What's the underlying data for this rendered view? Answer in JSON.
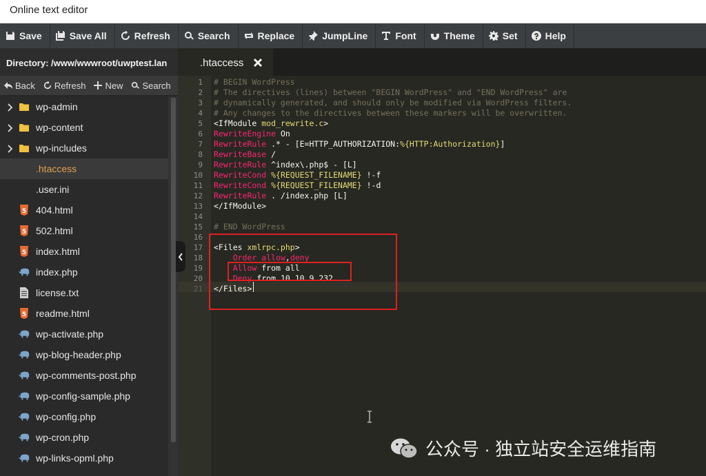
{
  "window": {
    "title": "Online text editor"
  },
  "toolbar": {
    "buttons": [
      {
        "label": "Save",
        "icon": "floppy-icon"
      },
      {
        "label": "Save All",
        "icon": "save-all-icon"
      },
      {
        "label": "Refresh",
        "icon": "refresh-icon"
      },
      {
        "label": "Search",
        "icon": "search-icon"
      },
      {
        "label": "Replace",
        "icon": "replace-icon"
      },
      {
        "label": "JumpLine",
        "icon": "pin-icon"
      },
      {
        "label": "Font",
        "icon": "font-icon"
      },
      {
        "label": "Theme",
        "icon": "magnet-icon"
      },
      {
        "label": "Set",
        "icon": "gear-icon"
      },
      {
        "label": "Help",
        "icon": "help-icon"
      }
    ]
  },
  "sidebar": {
    "directory": "Directory: /www/wwwroot/uwptest.lan",
    "actions": [
      {
        "label": "Back",
        "icon": "back-icon"
      },
      {
        "label": "Refresh",
        "icon": "refresh-icon"
      },
      {
        "label": "New",
        "icon": "plus-icon"
      },
      {
        "label": "Search",
        "icon": "search-icon"
      }
    ],
    "items": [
      {
        "name": "wp-admin",
        "type": "folder"
      },
      {
        "name": "wp-content",
        "type": "folder"
      },
      {
        "name": "wp-includes",
        "type": "folder"
      },
      {
        "name": ".htaccess",
        "type": "file-plain",
        "active": true
      },
      {
        "name": ".user.ini",
        "type": "file-plain"
      },
      {
        "name": "404.html",
        "type": "html"
      },
      {
        "name": "502.html",
        "type": "html"
      },
      {
        "name": "index.html",
        "type": "html"
      },
      {
        "name": "index.php",
        "type": "php"
      },
      {
        "name": "license.txt",
        "type": "txt"
      },
      {
        "name": "readme.html",
        "type": "html"
      },
      {
        "name": "wp-activate.php",
        "type": "php"
      },
      {
        "name": "wp-blog-header.php",
        "type": "php"
      },
      {
        "name": "wp-comments-post.php",
        "type": "php"
      },
      {
        "name": "wp-config-sample.php",
        "type": "php"
      },
      {
        "name": "wp-config.php",
        "type": "php"
      },
      {
        "name": "wp-cron.php",
        "type": "php"
      },
      {
        "name": "wp-links-opml.php",
        "type": "php"
      }
    ]
  },
  "editor": {
    "tab": {
      "label": ".htaccess"
    },
    "lines": [
      [
        [
          "cm",
          "# BEGIN WordPress"
        ]
      ],
      [
        [
          "cm",
          "# The directives (lines) between \"BEGIN WordPress\" and \"END WordPress\" are"
        ]
      ],
      [
        [
          "cm",
          "# dynamically generated, and should only be modified via WordPress filters."
        ]
      ],
      [
        [
          "cm",
          "# Any changes to the directives between these markers will be overwritten."
        ]
      ],
      [
        [
          "tg",
          "<IfModule "
        ],
        [
          "st",
          "mod_rewrite.c"
        ],
        [
          "tg",
          ">"
        ]
      ],
      [
        [
          "kw",
          "RewriteEngine"
        ],
        [
          "tg",
          " On"
        ]
      ],
      [
        [
          "kw",
          "RewriteRule"
        ],
        [
          "tg",
          " .* - [E=HTTP_AUTHORIZATION:"
        ],
        [
          "st",
          "%{HTTP:Authorization}"
        ],
        [
          "tg",
          "]"
        ]
      ],
      [
        [
          "kw",
          "RewriteBase"
        ],
        [
          "tg",
          " /"
        ]
      ],
      [
        [
          "kw",
          "RewriteRule"
        ],
        [
          "tg",
          " ^index\\.php$ - [L]"
        ]
      ],
      [
        [
          "kw",
          "RewriteCond"
        ],
        [
          "tg",
          " "
        ],
        [
          "st",
          "%{REQUEST_FILENAME}"
        ],
        [
          "tg",
          " !-f"
        ]
      ],
      [
        [
          "kw",
          "RewriteCond"
        ],
        [
          "tg",
          " "
        ],
        [
          "st",
          "%{REQUEST_FILENAME}"
        ],
        [
          "tg",
          " !-d"
        ]
      ],
      [
        [
          "kw",
          "RewriteRule"
        ],
        [
          "tg",
          " . /index.php [L]"
        ]
      ],
      [
        [
          "tg",
          "</IfModule>"
        ]
      ],
      [],
      [
        [
          "cm",
          "# END WordPress"
        ]
      ],
      [],
      [
        [
          "tg",
          "<Files "
        ],
        [
          "st",
          "xmlrpc.php"
        ],
        [
          "tg",
          ">"
        ]
      ],
      [
        [
          "tg",
          "    "
        ],
        [
          "kw",
          "Order"
        ],
        [
          "tg",
          " "
        ],
        [
          "kw",
          "allow"
        ],
        [
          "tg",
          ","
        ],
        [
          "kw",
          "deny"
        ]
      ],
      [
        [
          "tg",
          "    "
        ],
        [
          "kw",
          "Allow"
        ],
        [
          "tg",
          " from all"
        ]
      ],
      [
        [
          "tg",
          "    "
        ],
        [
          "kw",
          "Deny"
        ],
        [
          "tg",
          " from 10.10.9.232"
        ]
      ],
      [
        [
          "tg",
          "</Files>"
        ]
      ]
    ]
  },
  "watermark": {
    "text": "公众号 · 独立站安全运维指南",
    "icon": "wechat-icon"
  }
}
